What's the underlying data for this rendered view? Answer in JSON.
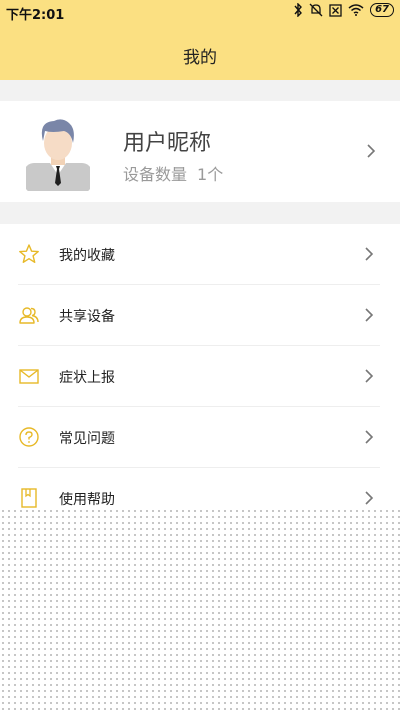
{
  "status_bar": {
    "time": "下午2:01",
    "icons": [
      "bluetooth-icon",
      "mute-icon",
      "sim-off-icon",
      "wifi-icon",
      "battery-icon"
    ],
    "battery": "67"
  },
  "header": {
    "title": "我的",
    "background": "#fbe082"
  },
  "profile": {
    "nickname": "用户昵称",
    "device_label": "设备数量",
    "device_count": "1个"
  },
  "menu": {
    "items": [
      {
        "label": "我的收藏",
        "icon": "star-icon"
      },
      {
        "label": "共享设备",
        "icon": "users-icon"
      },
      {
        "label": "症状上报",
        "icon": "mail-icon"
      },
      {
        "label": "常见问题",
        "icon": "question-icon"
      },
      {
        "label": "使用帮助",
        "icon": "book-icon"
      }
    ],
    "icon_color": "#e7b928"
  }
}
